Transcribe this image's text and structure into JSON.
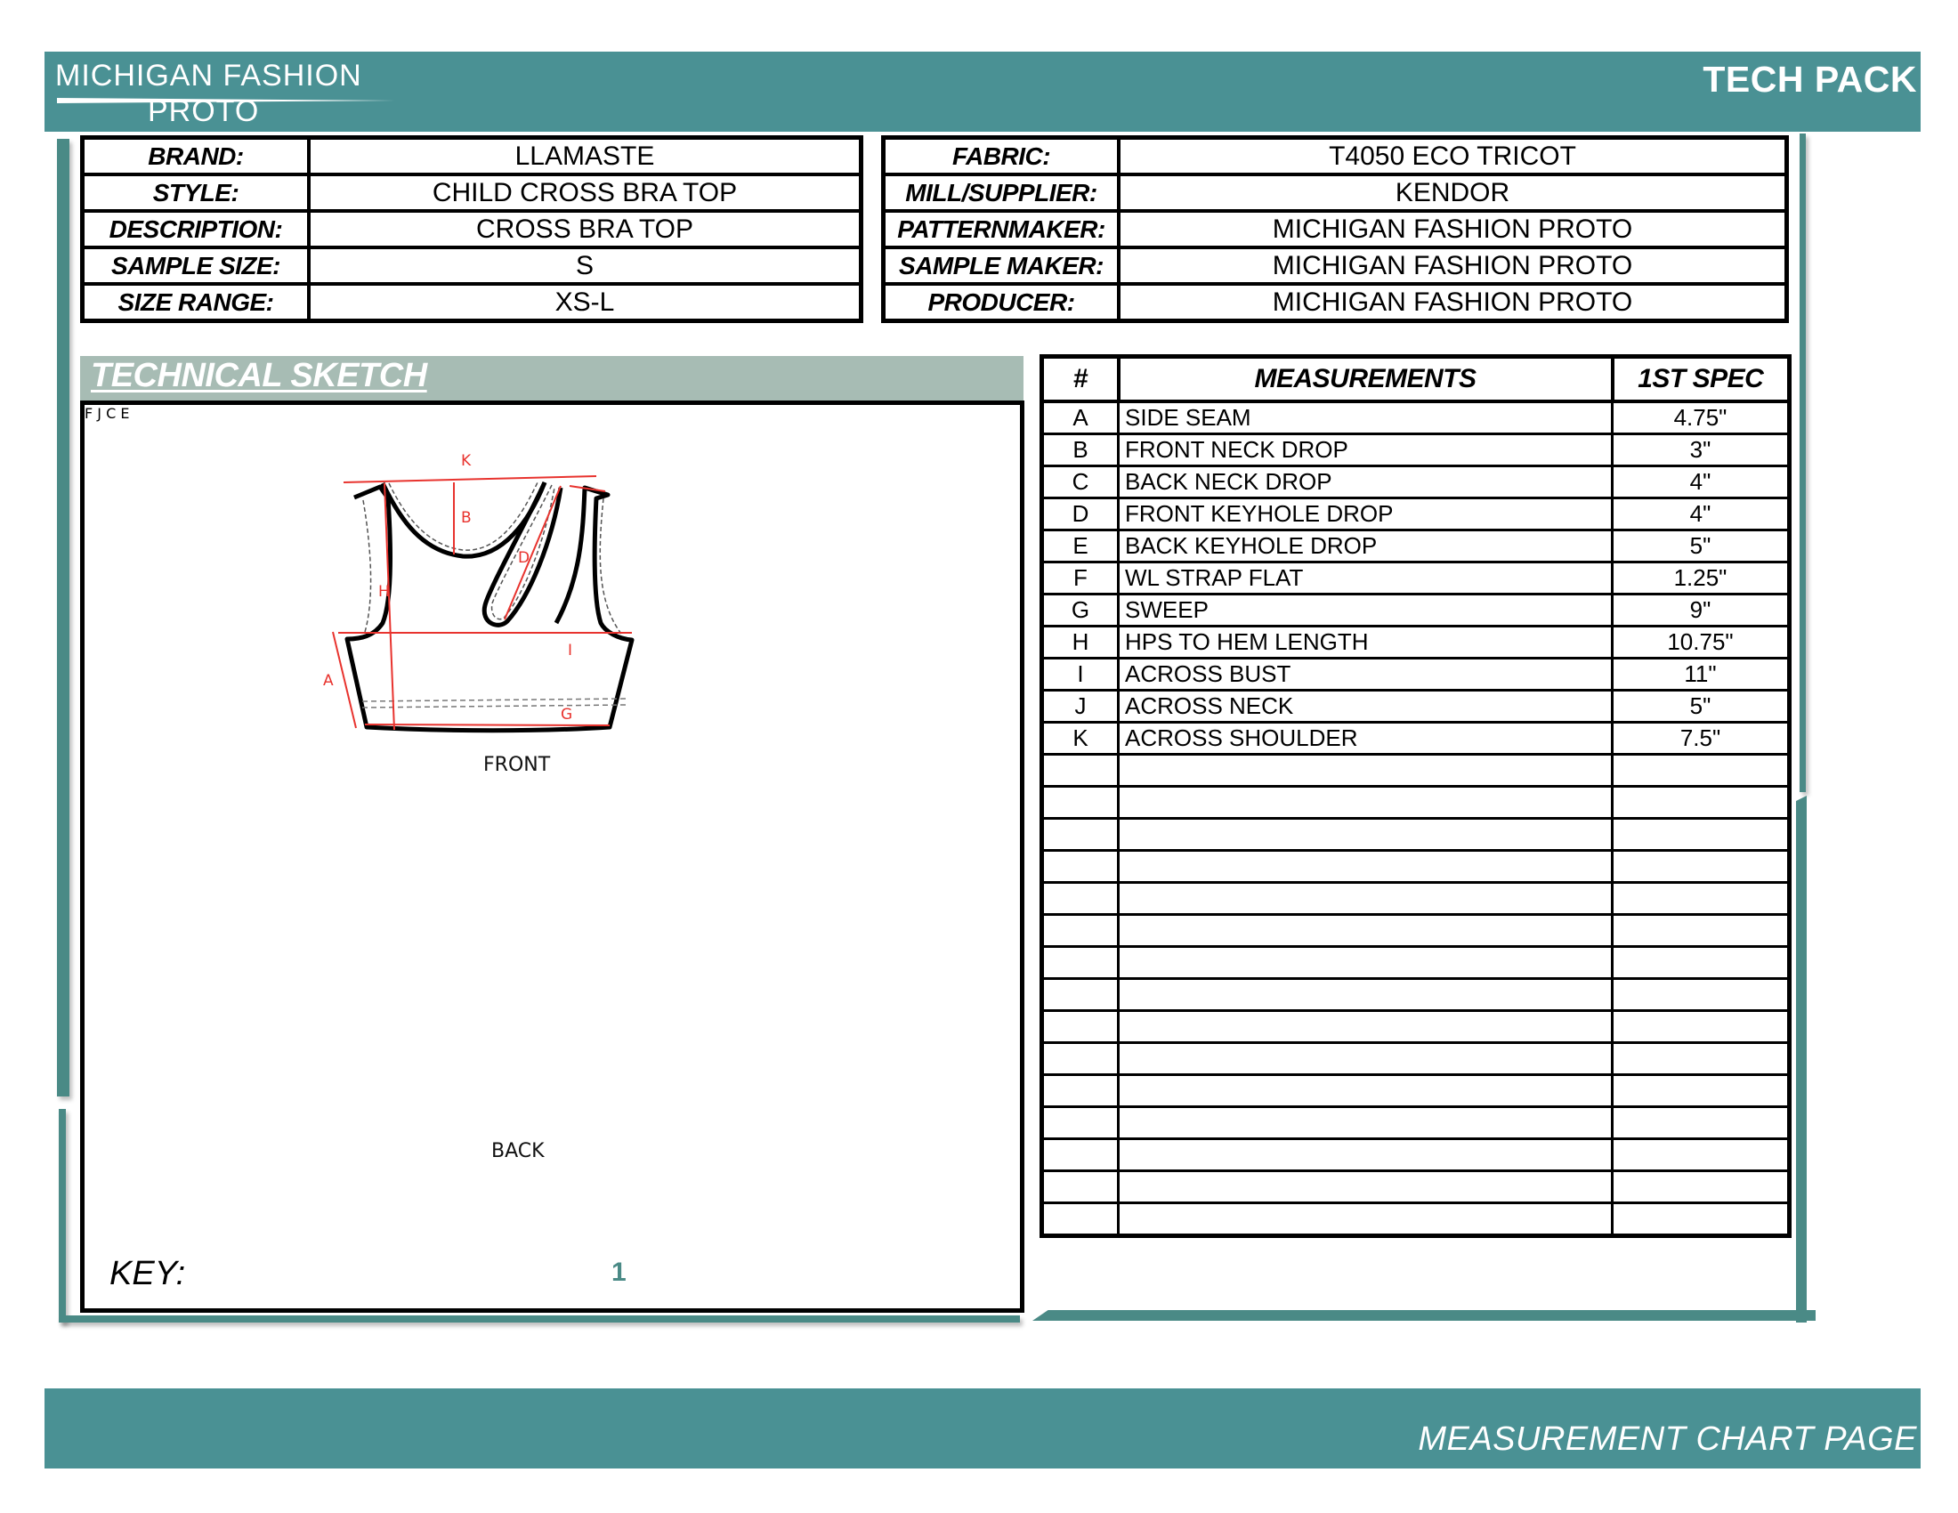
{
  "header": {
    "logo_line1": "MICHIGAN FASHION",
    "logo_line2": "PROTO",
    "doc_type": "TECH PACK"
  },
  "colors": {
    "brand_teal": "#4a9194",
    "section_header_gray_green": "#a7bcb4",
    "measurement_line_red": "#e8332e"
  },
  "product_info": [
    {
      "label": "BRAND:",
      "value": "LLAMASTE"
    },
    {
      "label": "STYLE:",
      "value": "CHILD CROSS BRA TOP"
    },
    {
      "label": "DESCRIPTION:",
      "value": "CROSS BRA TOP"
    },
    {
      "label": "SAMPLE SIZE:",
      "value": "S"
    },
    {
      "label": "SIZE RANGE:",
      "value": "XS-L"
    }
  ],
  "production_info": [
    {
      "label": "FABRIC:",
      "value": "T4050 ECO TRICOT"
    },
    {
      "label": "MILL/SUPPLIER:",
      "value": "KENDOR"
    },
    {
      "label": "PATTERNMAKER:",
      "value": "MICHIGAN FASHION PROTO"
    },
    {
      "label": "SAMPLE MAKER:",
      "value": "MICHIGAN FASHION PROTO"
    },
    {
      "label": "PRODUCER:",
      "value": "MICHIGAN FASHION PROTO"
    }
  ],
  "sketch": {
    "title": "TECHNICAL SKETCH",
    "front_label": "FRONT",
    "back_label": "BACK",
    "front_callouts": [
      "K",
      "B",
      "D",
      "H",
      "I",
      "A",
      "G"
    ],
    "back_callouts": [
      "F",
      "J",
      "C",
      "E"
    ],
    "key_label": "KEY:",
    "key_icons": [
      "vertical-double-arrow",
      "horizontal-double-arrow",
      "right-angle-up-arrow",
      "bracket"
    ],
    "key_number": "1"
  },
  "measurements": {
    "headers": [
      "#",
      "MEASUREMENTS",
      "1ST SPEC"
    ],
    "rows": [
      {
        "code": "A",
        "name": "SIDE SEAM",
        "spec": "4.75\""
      },
      {
        "code": "B",
        "name": "FRONT NECK DROP",
        "spec": "3\""
      },
      {
        "code": "C",
        "name": "BACK NECK DROP",
        "spec": "4\""
      },
      {
        "code": "D",
        "name": "FRONT KEYHOLE DROP",
        "spec": "4\""
      },
      {
        "code": "E",
        "name": "BACK KEYHOLE DROP",
        "spec": "5\""
      },
      {
        "code": "F",
        "name": "WL STRAP FLAT",
        "spec": "1.25\""
      },
      {
        "code": "G",
        "name": "SWEEP",
        "spec": "9\""
      },
      {
        "code": "H",
        "name": "HPS TO HEM LENGTH",
        "spec": "10.75\""
      },
      {
        "code": "I",
        "name": "ACROSS BUST",
        "spec": "11\""
      },
      {
        "code": "J",
        "name": "ACROSS NECK",
        "spec": "5\""
      },
      {
        "code": "K",
        "name": "ACROSS SHOULDER",
        "spec": "7.5\""
      },
      {
        "code": "",
        "name": "",
        "spec": ""
      },
      {
        "code": "",
        "name": "",
        "spec": ""
      },
      {
        "code": "",
        "name": "",
        "spec": ""
      },
      {
        "code": "",
        "name": "",
        "spec": ""
      },
      {
        "code": "",
        "name": "",
        "spec": ""
      },
      {
        "code": "",
        "name": "",
        "spec": ""
      },
      {
        "code": "",
        "name": "",
        "spec": ""
      },
      {
        "code": "",
        "name": "",
        "spec": ""
      },
      {
        "code": "",
        "name": "",
        "spec": ""
      },
      {
        "code": "",
        "name": "",
        "spec": ""
      },
      {
        "code": "",
        "name": "",
        "spec": ""
      },
      {
        "code": "",
        "name": "",
        "spec": ""
      },
      {
        "code": "",
        "name": "",
        "spec": ""
      },
      {
        "code": "",
        "name": "",
        "spec": ""
      },
      {
        "code": "",
        "name": "",
        "spec": ""
      }
    ]
  },
  "footer": {
    "page_title": "MEASUREMENT CHART PAGE"
  }
}
